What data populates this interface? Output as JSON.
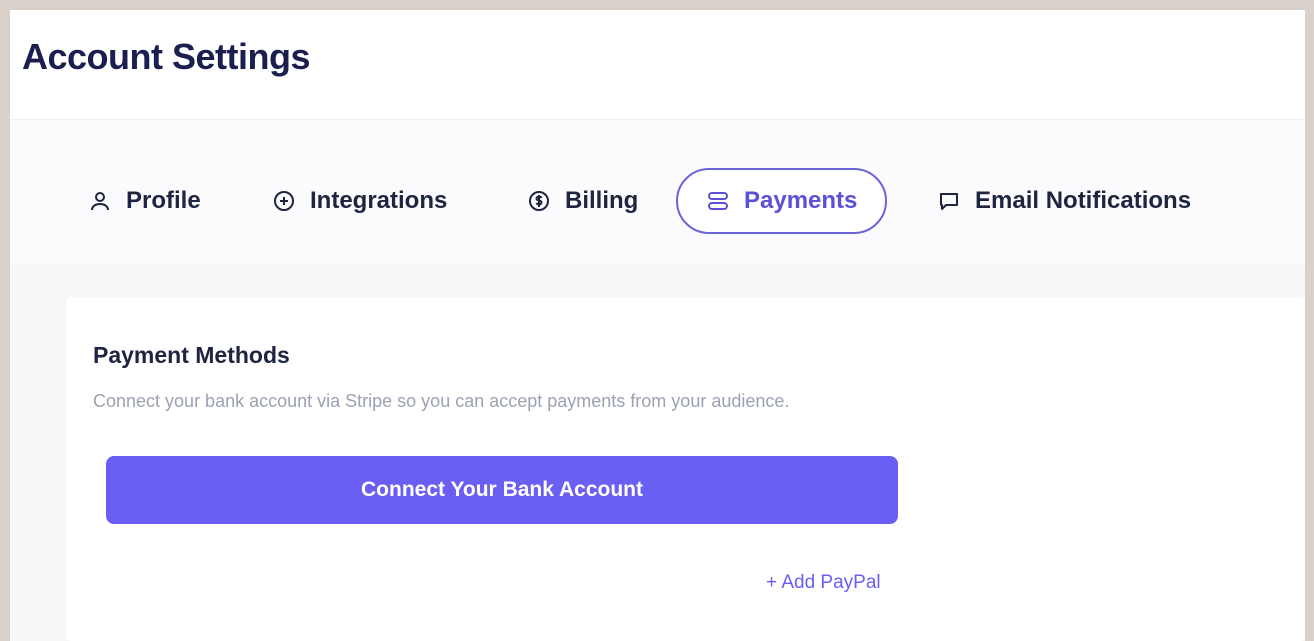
{
  "page": {
    "title": "Account Settings"
  },
  "tabs": [
    {
      "label": "Profile",
      "icon": "user-icon",
      "active": false
    },
    {
      "label": "Integrations",
      "icon": "plus-circle-icon",
      "active": false
    },
    {
      "label": "Billing",
      "icon": "dollar-circle-icon",
      "active": false
    },
    {
      "label": "Payments",
      "icon": "stack-icon",
      "active": true
    },
    {
      "label": "Email Notifications",
      "icon": "chat-bubble-icon",
      "active": false
    }
  ],
  "payment_methods": {
    "title": "Payment Methods",
    "description": "Connect your bank account via Stripe so you can accept payments from your audience.",
    "connect_button": "Connect Your Bank Account",
    "add_paypal": "+ Add PayPal"
  },
  "colors": {
    "accent": "#6a5ff2",
    "title_text": "#1b1f4f",
    "muted_text": "#9ca1b3",
    "frame_border": "#d9d1c9"
  }
}
